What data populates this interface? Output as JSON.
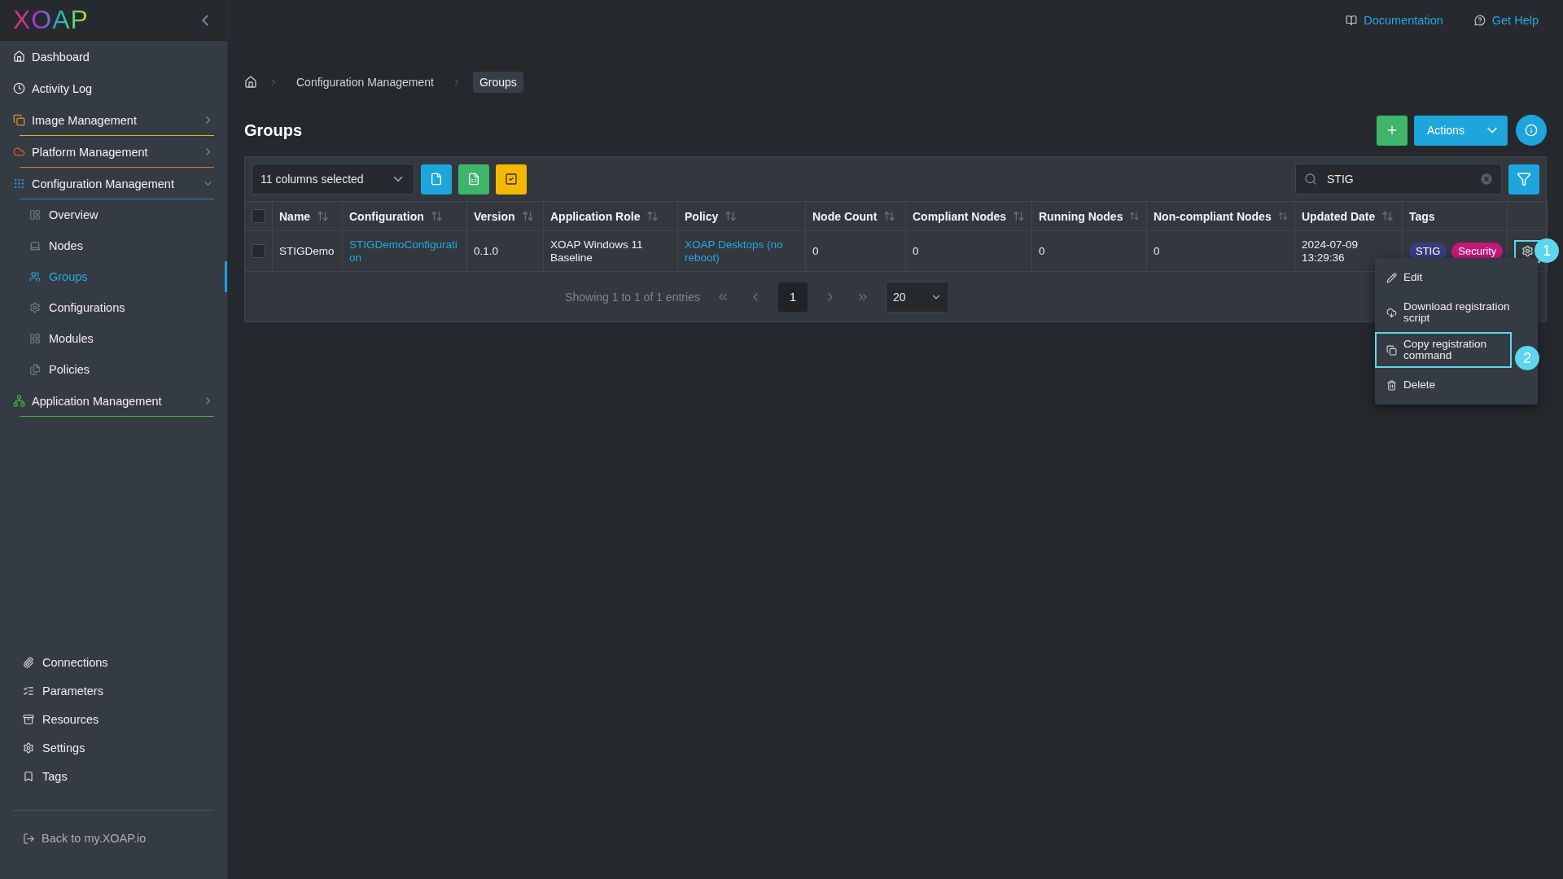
{
  "sidebar": {
    "logo": "XOAP",
    "items": [
      {
        "label": "Dashboard"
      },
      {
        "label": "Activity Log"
      },
      {
        "label": "Image Management",
        "expanded": false,
        "color": "#d9b526"
      },
      {
        "label": "Platform Management",
        "expanded": false,
        "color": "#e8762a"
      },
      {
        "label": "Configuration Management",
        "expanded": true,
        "color": "#2d7fc9",
        "children": [
          {
            "label": "Overview",
            "selected": false
          },
          {
            "label": "Nodes",
            "selected": false
          },
          {
            "label": "Groups",
            "selected": true
          },
          {
            "label": "Configurations",
            "selected": false
          },
          {
            "label": "Modules",
            "selected": false
          },
          {
            "label": "Policies",
            "selected": false
          }
        ]
      },
      {
        "label": "Application Management",
        "expanded": false,
        "color": "#3db54a"
      }
    ],
    "bottom_items": [
      {
        "label": "Connections"
      },
      {
        "label": "Parameters"
      },
      {
        "label": "Resources"
      },
      {
        "label": "Settings"
      },
      {
        "label": "Tags"
      }
    ],
    "back_link": "Back to my.XOAP.io"
  },
  "top_bar": {
    "links": [
      "Documentation",
      "Get Help"
    ]
  },
  "breadcrumb": [
    "Configuration Management",
    "Groups"
  ],
  "page_title": "Groups",
  "header_buttons": {
    "actions": "Actions"
  },
  "toolbar": {
    "columns_select": "11 columns selected",
    "search": {
      "value": "STIG"
    }
  },
  "table": {
    "all_checked": false,
    "columns": [
      {
        "label": "Name",
        "sortable": true
      },
      {
        "label": "Configuration",
        "sortable": true
      },
      {
        "label": "Version",
        "sortable": true
      },
      {
        "label": "Application Role",
        "sortable": true
      },
      {
        "label": "Policy",
        "sortable": true
      },
      {
        "label": "Node Count",
        "sortable": true
      },
      {
        "label": "Compliant Nodes",
        "sortable": true
      },
      {
        "label": "Running Nodes",
        "sortable": true
      },
      {
        "label": "Non-compliant Nodes",
        "sortable": true
      },
      {
        "label": "Updated Date",
        "sortable": true
      },
      {
        "label": "Tags",
        "sortable": false
      }
    ],
    "rows": [
      {
        "checked": false,
        "cells": [
          {
            "text": "STIGDemo",
            "kind": "text"
          },
          {
            "text": "STIGDemoConfiguration",
            "kind": "link"
          },
          {
            "text": "0.1.0",
            "kind": "text"
          },
          {
            "text": "XOAP Windows 11 Baseline",
            "kind": "text"
          },
          {
            "text": "XOAP Desktops (no reboot)",
            "kind": "link"
          },
          {
            "text": "0",
            "kind": "text"
          },
          {
            "text": "0",
            "kind": "text"
          },
          {
            "text": "0",
            "kind": "text"
          },
          {
            "text": "0",
            "kind": "text"
          },
          {
            "text": "2024-07-09 13:29:36",
            "kind": "text"
          }
        ],
        "tags": [
          {
            "label": "STIG",
            "color": "#363c7e"
          },
          {
            "label": "Security",
            "color": "#c2197a"
          }
        ]
      }
    ]
  },
  "pagination": {
    "summary": "Showing 1 to 1 of 1 entries",
    "pages": [
      {
        "label": "1",
        "selected": true
      }
    ],
    "page_size": "20"
  },
  "row_menu": {
    "items": [
      {
        "label": "Edit",
        "focused": false
      },
      {
        "label": "Download registration script",
        "focused": false
      },
      {
        "label": "Copy registration command",
        "focused": true
      },
      {
        "label": "Delete",
        "focused": false
      }
    ]
  },
  "annotations": [
    "1",
    "2"
  ]
}
